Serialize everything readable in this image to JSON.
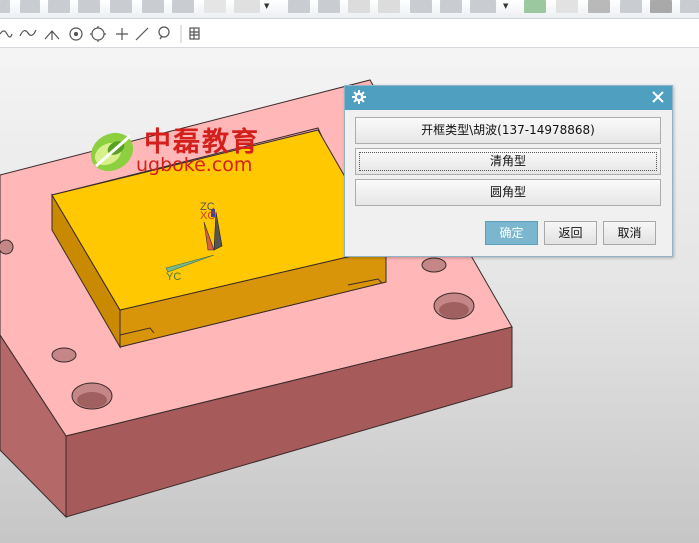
{
  "dialog": {
    "options": [
      "开框类型\\胡波(137-14978868)",
      "清角型",
      "圆角型"
    ],
    "ok_label": "确定",
    "back_label": "返回",
    "cancel_label": "取消"
  },
  "watermark": {
    "title": "中磊教育",
    "url": "ugboke.com"
  },
  "csys": {
    "zc": "ZC",
    "xc": "XC",
    "yc": "YC"
  },
  "colors": {
    "dialog_title_bar": "#4fa0c0",
    "primary_button": "#7ab7cf",
    "plate_top": "#ffb7b7",
    "plate_side": "#a65a5a",
    "insert_top": "#ffc800",
    "insert_side": "#c98a00",
    "watermark_red": "#d4201c"
  },
  "icons": [
    "curve-icon",
    "spline-icon",
    "point-set-icon",
    "circle-center-icon",
    "circle-icon",
    "cross-point-icon",
    "line-icon",
    "pin-icon",
    "table-icon",
    "settings-gear-icon",
    "close-icon"
  ]
}
